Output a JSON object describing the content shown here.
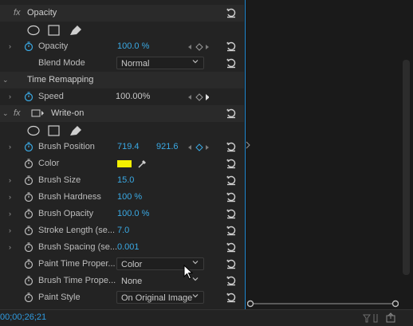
{
  "sections": {
    "opacity": {
      "fx": "fx",
      "title": "Opacity"
    },
    "time_remapping": {
      "title": "Time Remapping"
    },
    "write_on": {
      "fx": "fx",
      "title": "Write-on"
    }
  },
  "properties": {
    "opacity": {
      "label": "Opacity",
      "value": "100.0 %"
    },
    "blend_mode": {
      "label": "Blend Mode",
      "value": "Normal"
    },
    "speed": {
      "label": "Speed",
      "value": "100.00%"
    },
    "brush_position": {
      "label": "Brush Position",
      "x": "719.4",
      "y": "921.6"
    },
    "color": {
      "label": "Color",
      "swatch": "#f4f000"
    },
    "brush_size": {
      "label": "Brush Size",
      "value": "15.0"
    },
    "brush_hardness": {
      "label": "Brush Hardness",
      "value": "100 %"
    },
    "brush_opacity": {
      "label": "Brush Opacity",
      "value": "100.0 %"
    },
    "stroke_length": {
      "label": "Stroke Length (se...",
      "value": "7.0"
    },
    "brush_spacing": {
      "label": "Brush Spacing (se...",
      "value": "0.001"
    },
    "paint_time": {
      "label": "Paint Time Proper...",
      "value": "Color"
    },
    "brush_time": {
      "label": "Brush Time Prope...",
      "value": "None"
    },
    "paint_style": {
      "label": "Paint Style",
      "value": "On Original Image"
    }
  },
  "footer": {
    "timecode": "00;00;26;21"
  },
  "colors": {
    "accent": "#3aa9e4",
    "playhead": "#1f8ad3",
    "swatch": "#f4f000"
  }
}
